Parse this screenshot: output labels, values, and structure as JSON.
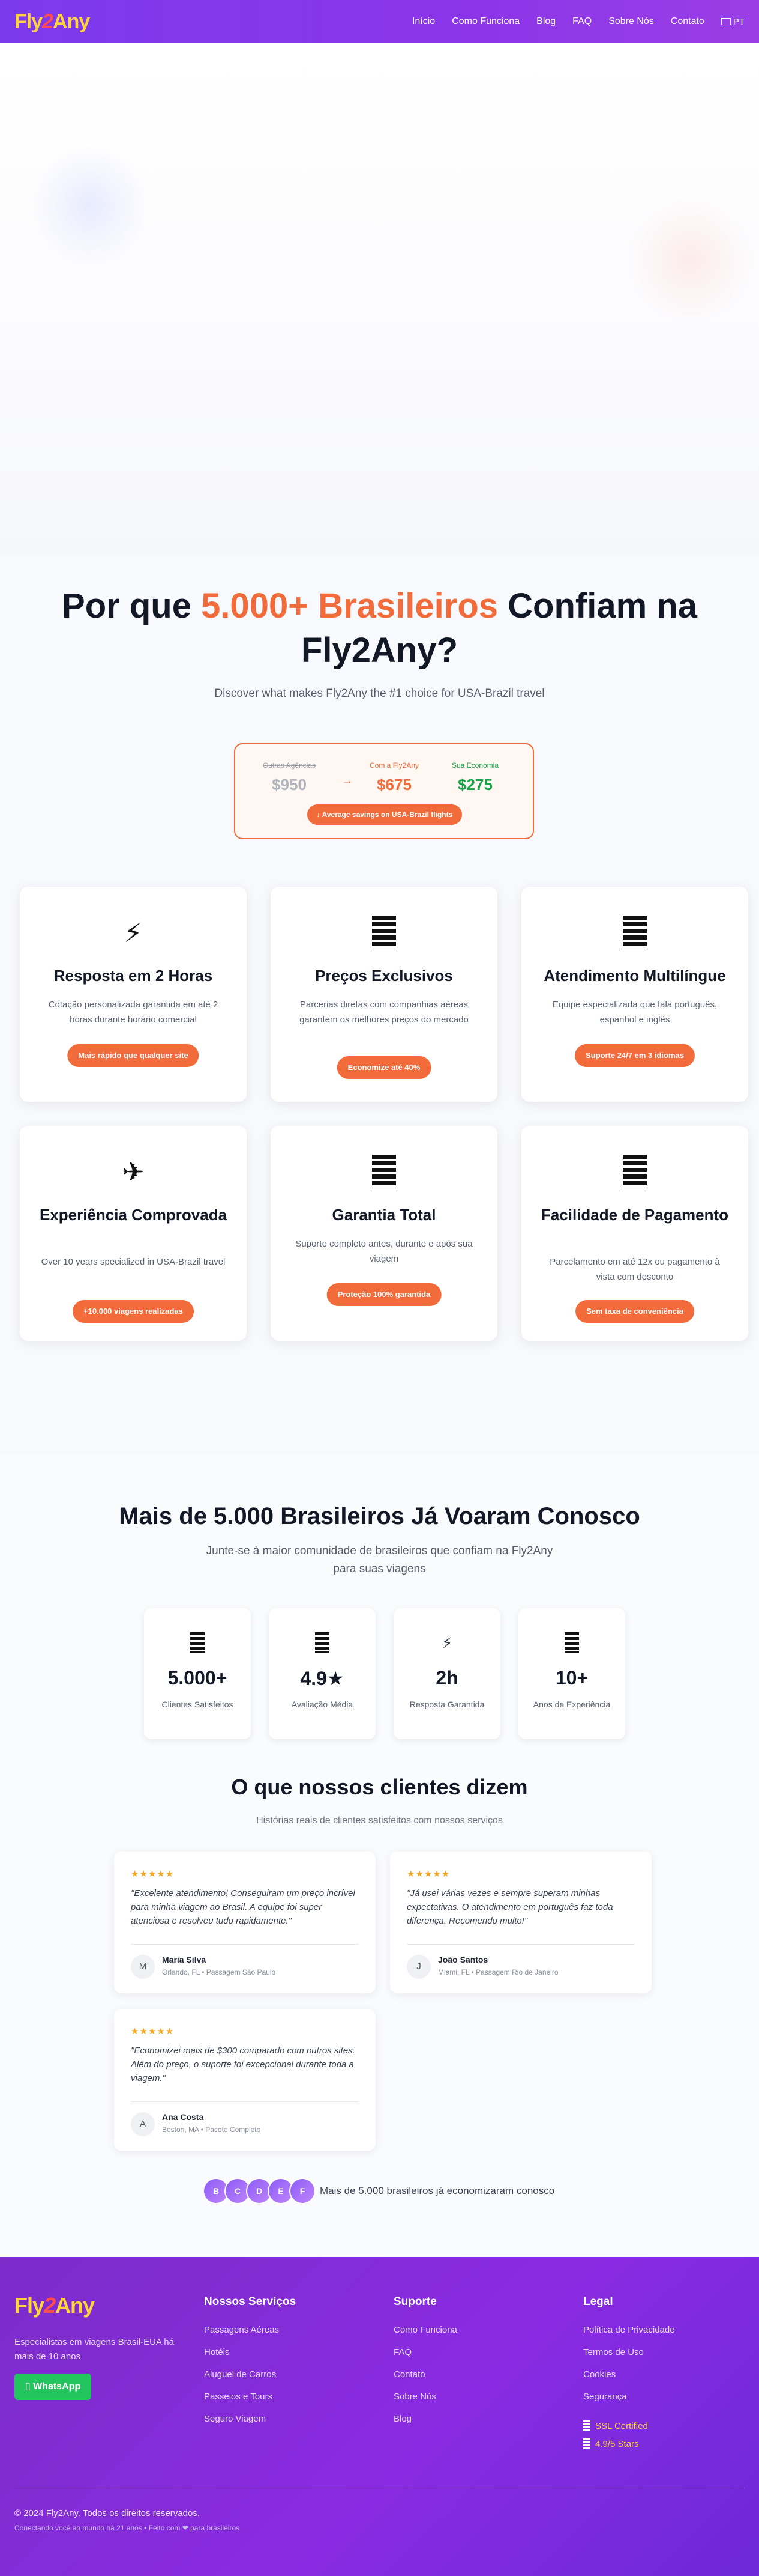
{
  "nav": {
    "logo": {
      "fly": "Fly",
      "two": "2",
      "any": "Any"
    },
    "links": [
      "Início",
      "Como Funciona",
      "Blog",
      "FAQ",
      "Sobre Nós",
      "Contato"
    ],
    "lang": "PT"
  },
  "why": {
    "title_pre": "Por que ",
    "title_highlight": "5.000+ Brasileiros",
    "title_post": " Confiam na Fly2Any?",
    "subtitle": "Discover what makes Fly2Any the #1 choice for USA-Brazil travel",
    "savings": {
      "old_label": "Outras Agências",
      "old_value": "$950",
      "arrow": "→",
      "new_label": "Com a Fly2Any",
      "new_value": "$675",
      "eco_label": "Sua Economia",
      "eco_value": "$275",
      "pill": "↓ Average savings on USA-Brazil flights"
    },
    "cards": [
      {
        "icon": "⚡",
        "title": "Resposta em 2 Horas",
        "text": "Cotação personalizada garantida em até 2 horas durante horário comercial",
        "pill": "Mais rápido que qualquer site"
      },
      {
        "icon": "bars",
        "title": "Preços Exclusivos",
        "text": "Parcerias diretas com companhias aéreas garantem os melhores preços do mercado",
        "pill": "Economize até 40%"
      },
      {
        "icon": "bars",
        "title": "Atendimento Multilíngue",
        "text": "Equipe especializada que fala português, espanhol e inglês",
        "pill": "Suporte 24/7 em 3 idiomas"
      },
      {
        "icon": "✈",
        "title": "Experiência Comprovada",
        "text": "Over 10 years specialized in USA-Brazil travel",
        "pill": "+10.000 viagens realizadas"
      },
      {
        "icon": "bars",
        "title": "Garantia Total",
        "text": "Suporte completo antes, durante e após sua viagem",
        "pill": "Proteção 100% garantida"
      },
      {
        "icon": "bars",
        "title": "Facilidade de Pagamento",
        "text": "Parcelamento em até 12x ou pagamento à vista com desconto",
        "pill": "Sem taxa de conveniência"
      }
    ]
  },
  "social": {
    "title": "Mais de 5.000 Brasileiros Já Voaram Conosco",
    "subtitle": "Junte-se à maior comunidade de brasileiros que confiam na Fly2Any para suas viagens",
    "stats": [
      {
        "icon": "bars",
        "value": "5.000+",
        "label": "Clientes Satisfeitos"
      },
      {
        "icon": "bars",
        "value": "4.9★",
        "label": "Avaliação Média"
      },
      {
        "icon": "⚡",
        "value": "2h",
        "label": "Resposta Garantida"
      },
      {
        "icon": "bars",
        "value": "10+",
        "label": "Anos de Experiência"
      }
    ],
    "testimonials_title": "O que nossos clientes dizem",
    "testimonials_sub": "Histórias reais de clientes satisfeitos com nossos serviços",
    "testimonials": [
      {
        "stars": "★★★★★",
        "quote": "\"Excelente atendimento! Conseguiram um preço incrível para minha viagem ao Brasil. A equipe foi super atenciosa e resolveu tudo rapidamente.\"",
        "initial": "M",
        "name": "Maria Silva",
        "meta": "Orlando, FL • Passagem São Paulo"
      },
      {
        "stars": "★★★★★",
        "quote": "\"Já usei várias vezes e sempre superam minhas expectativas. O atendimento em português faz toda diferença. Recomendo muito!\"",
        "initial": "J",
        "name": "João Santos",
        "meta": "Miami, FL • Passagem Rio de Janeiro"
      },
      {
        "stars": "★★★★★",
        "quote": "\"Economizei mais de $300 comparado com outros sites. Além do preço, o suporte foi excepcional durante toda a viagem.\"",
        "initial": "A",
        "name": "Ana Costa",
        "meta": "Boston, MA • Pacote Completo"
      }
    ],
    "avatars": [
      "B",
      "C",
      "D",
      "E",
      "F"
    ],
    "avatars_text": "Mais de 5.000 brasileiros já economizaram conosco"
  },
  "footer": {
    "description": "Especialistas em viagens Brasil-EUA há mais de 10 anos",
    "whatsapp": "WhatsApp",
    "services_title": "Nossos Serviços",
    "services": [
      "Passagens Aéreas",
      "Hotéis",
      "Aluguel de Carros",
      "Passeios e Tours",
      "Seguro Viagem"
    ],
    "support_title": "Suporte",
    "support": [
      "Como Funciona",
      "FAQ",
      "Contato",
      "Sobre Nós",
      "Blog"
    ],
    "legal_title": "Legal",
    "legal": [
      "Política de Privacidade",
      "Termos de Uso",
      "Cookies",
      "Segurança"
    ],
    "badges": [
      "SSL Certified",
      "4.9/5 Stars"
    ],
    "copyright": "© 2024 Fly2Any. Todos os direitos reservados.",
    "made": "Conectando você ao mundo há 21 anos • Feito com ❤ para brasileiros"
  }
}
